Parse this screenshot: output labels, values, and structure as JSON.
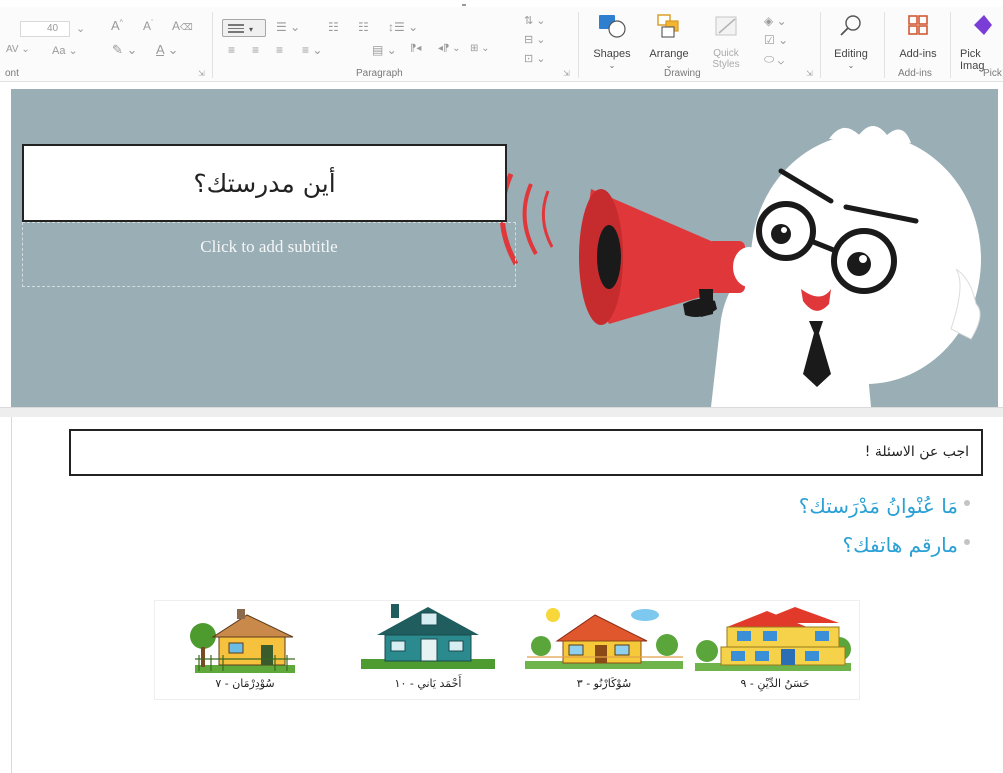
{
  "ribbon": {
    "font_size": "40",
    "font_group_label": "ont",
    "paragraph_group_label": "Paragraph",
    "drawing_group_label": "Drawing",
    "addins_group_label": "Add-ins",
    "picker_group_label": "Pick",
    "shapes_label": "Shapes",
    "arrange_label": "Arrange",
    "quick_styles_label": "Quick",
    "quick_styles_label2": "Styles",
    "editing_label": "Editing",
    "addins_label": "Add-ins",
    "picker_label": "Pick",
    "picker_label2": "Imag",
    "grow_font": "A",
    "shrink_font": "A",
    "char_spacing": "AV",
    "change_case": "Aa"
  },
  "slide1": {
    "title": "أين مدرستك؟",
    "subtitle_placeholder": "Click to add subtitle"
  },
  "slide2": {
    "prompt": "اجب عن الاسئلة !",
    "questions": [
      "مَا عُنْوانُ مَدْرَستك؟",
      "مارقم هاتفك؟"
    ],
    "houses": [
      {
        "caption": "سُوْدِرْمَان - ٧"
      },
      {
        "caption": "أَحْمَد يَاني - ١٠"
      },
      {
        "caption": "سُوْكَارْنُو - ٣"
      },
      {
        "caption": "حَسَنُ الدِّيْنِ - ٩"
      }
    ]
  },
  "colors": {
    "slide_bg": "#9aaeb5",
    "megaphone_red": "#e0383a",
    "question_blue": "#2aa0d5",
    "addins_orange": "#d35a34"
  }
}
